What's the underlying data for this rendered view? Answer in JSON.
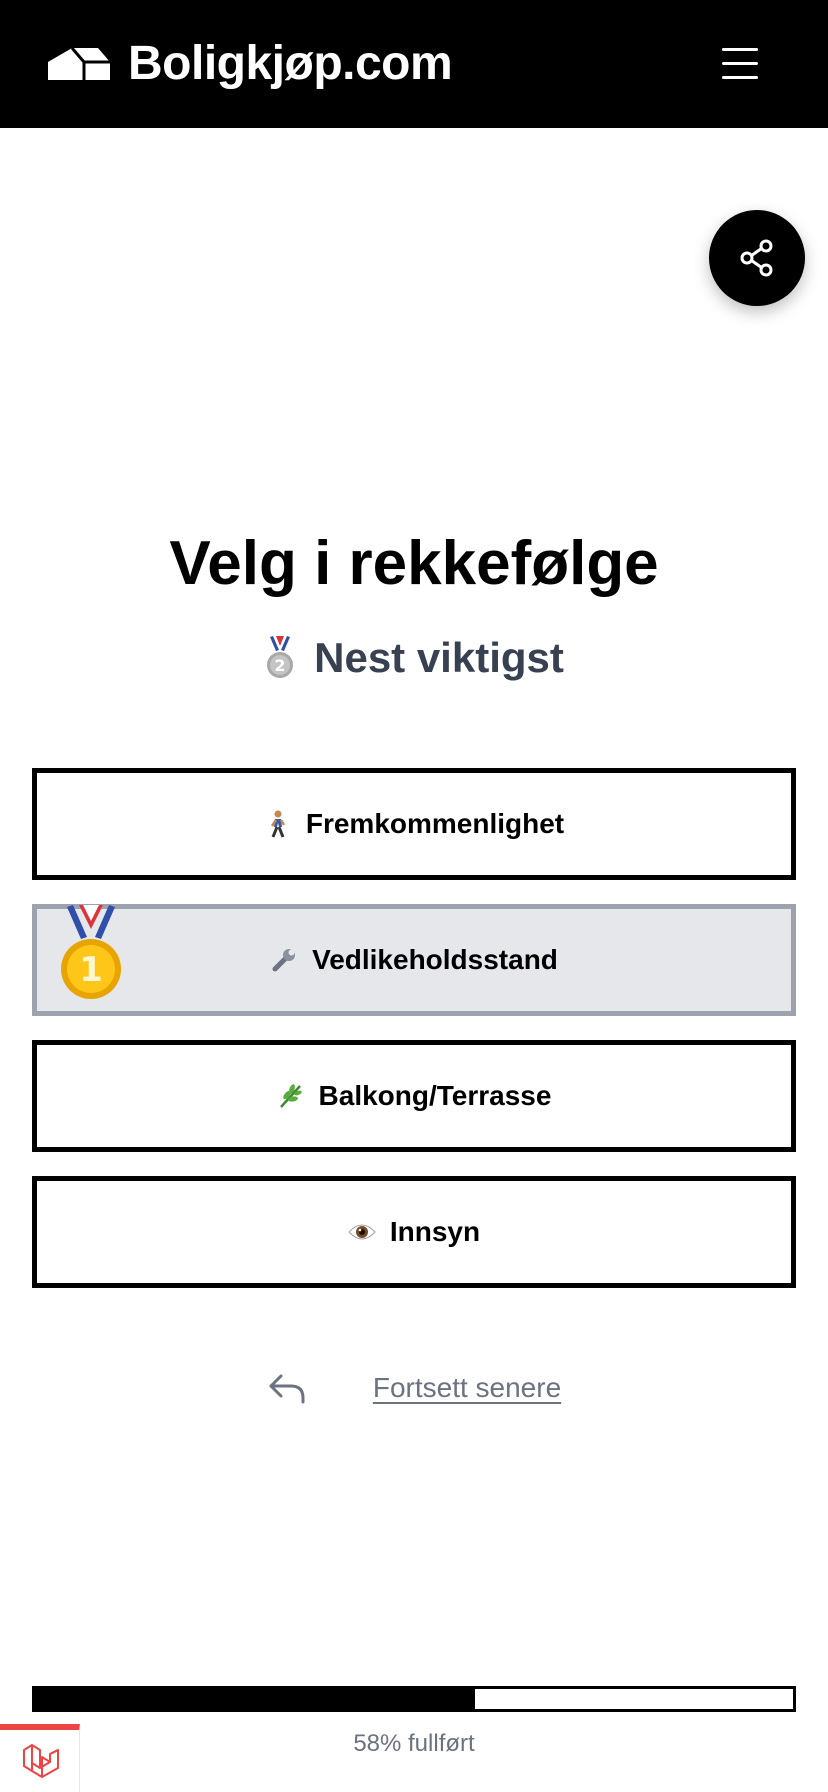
{
  "header": {
    "brand": "Boligkjøp.com",
    "logo_icon": "house-roof-icon",
    "menu_icon": "hamburger-menu-icon"
  },
  "share": {
    "icon": "share-icon"
  },
  "question": {
    "title": "Velg i rekkefølge",
    "rank_label": "Nest viktigst",
    "rank_icon": "second-place-medal-icon"
  },
  "options": [
    {
      "label": "Fremkommenlighet",
      "icon": "person-walking-icon",
      "selected": false
    },
    {
      "label": "Vedlikeholdsstand",
      "icon": "wrench-icon",
      "selected": true,
      "rank_badge": "first-place-medal-icon"
    },
    {
      "label": "Balkong/Terrasse",
      "icon": "herb-leaf-icon",
      "selected": false
    },
    {
      "label": "Innsyn",
      "icon": "eye-icon",
      "selected": false
    }
  ],
  "footer": {
    "continue_label": "Fortsett senere",
    "back_icon": "reply-arrow-icon",
    "progress_percent": 58,
    "progress_text": "58% fullført"
  },
  "colors": {
    "header_bg": "#000000",
    "selected_bg": "#e5e7eb",
    "selected_border": "#9ca3af",
    "muted_text": "#6b7280",
    "subtitle_text": "#374151",
    "dev_badge_accent": "#ef4444"
  }
}
